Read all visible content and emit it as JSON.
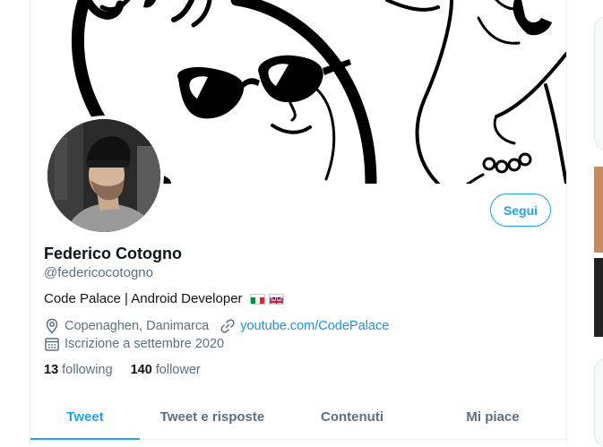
{
  "profile": {
    "name": "Federico Cotogno",
    "handle": "@federicocotogno",
    "bio": "Code Palace | Android Developer",
    "location": "Copenaghen, Danimarca",
    "website": "youtube.com/CodePalace",
    "joined": "Iscrizione a settembre 2020",
    "following_count": "13",
    "following_label": "following",
    "followers_count": "140",
    "followers_label": "follower",
    "follow_button": "Segui"
  },
  "tabs": [
    {
      "label": "Tweet",
      "active": true
    },
    {
      "label": "Tweet e risposte",
      "active": false
    },
    {
      "label": "Contenuti",
      "active": false
    },
    {
      "label": "Mi piace",
      "active": false
    }
  ],
  "icons": {
    "location": "location-pin-icon",
    "link": "link-icon",
    "calendar": "calendar-icon",
    "flags": [
      "italy-flag",
      "uk-flag"
    ]
  },
  "colors": {
    "accent": "#1da1f2",
    "link": "#1b95e0",
    "secondary_text": "#5b7083",
    "primary_text": "#0f1419"
  }
}
